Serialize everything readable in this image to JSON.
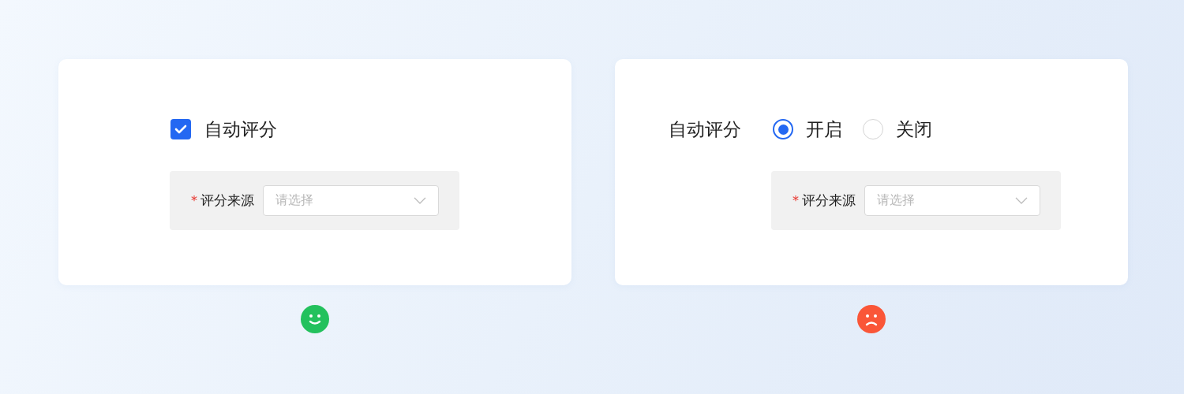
{
  "cards": [
    {
      "kind": "checkbox",
      "label": "自动评分",
      "checked": true,
      "field": {
        "required_mark": "*",
        "label": "评分来源",
        "placeholder": "请选择"
      },
      "face": {
        "kind": "happy"
      }
    },
    {
      "kind": "radio",
      "label": "自动评分",
      "options": [
        {
          "label": "开启",
          "selected": true
        },
        {
          "label": "关闭",
          "selected": false
        }
      ],
      "field": {
        "required_mark": "*",
        "label": "评分来源",
        "placeholder": "请选择"
      },
      "face": {
        "kind": "sad"
      }
    }
  ]
}
